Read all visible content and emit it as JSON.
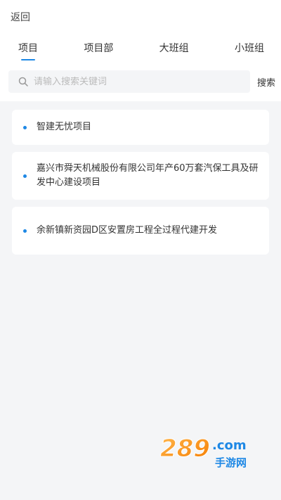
{
  "header": {
    "back_label": "返回"
  },
  "tabs": [
    {
      "label": "项目",
      "active": true
    },
    {
      "label": "项目部",
      "active": false
    },
    {
      "label": "大班组",
      "active": false
    },
    {
      "label": "小班组",
      "active": false
    }
  ],
  "search": {
    "placeholder": "请输入搜索关键词",
    "value": "",
    "button_label": "搜索",
    "icon": "search-icon"
  },
  "projects": [
    {
      "name": "智建无忧项目"
    },
    {
      "name": "嘉兴市舜天机械股份有限公司年产60万套汽保工具及研发中心建设项目"
    },
    {
      "name": "余新镇新资园D区安置房工程全过程代建开发"
    }
  ],
  "watermark": {
    "text_main": "289.com",
    "text_sub": "手游网"
  },
  "colors": {
    "accent": "#1e88e5",
    "list_background": "#f4f5f7"
  }
}
